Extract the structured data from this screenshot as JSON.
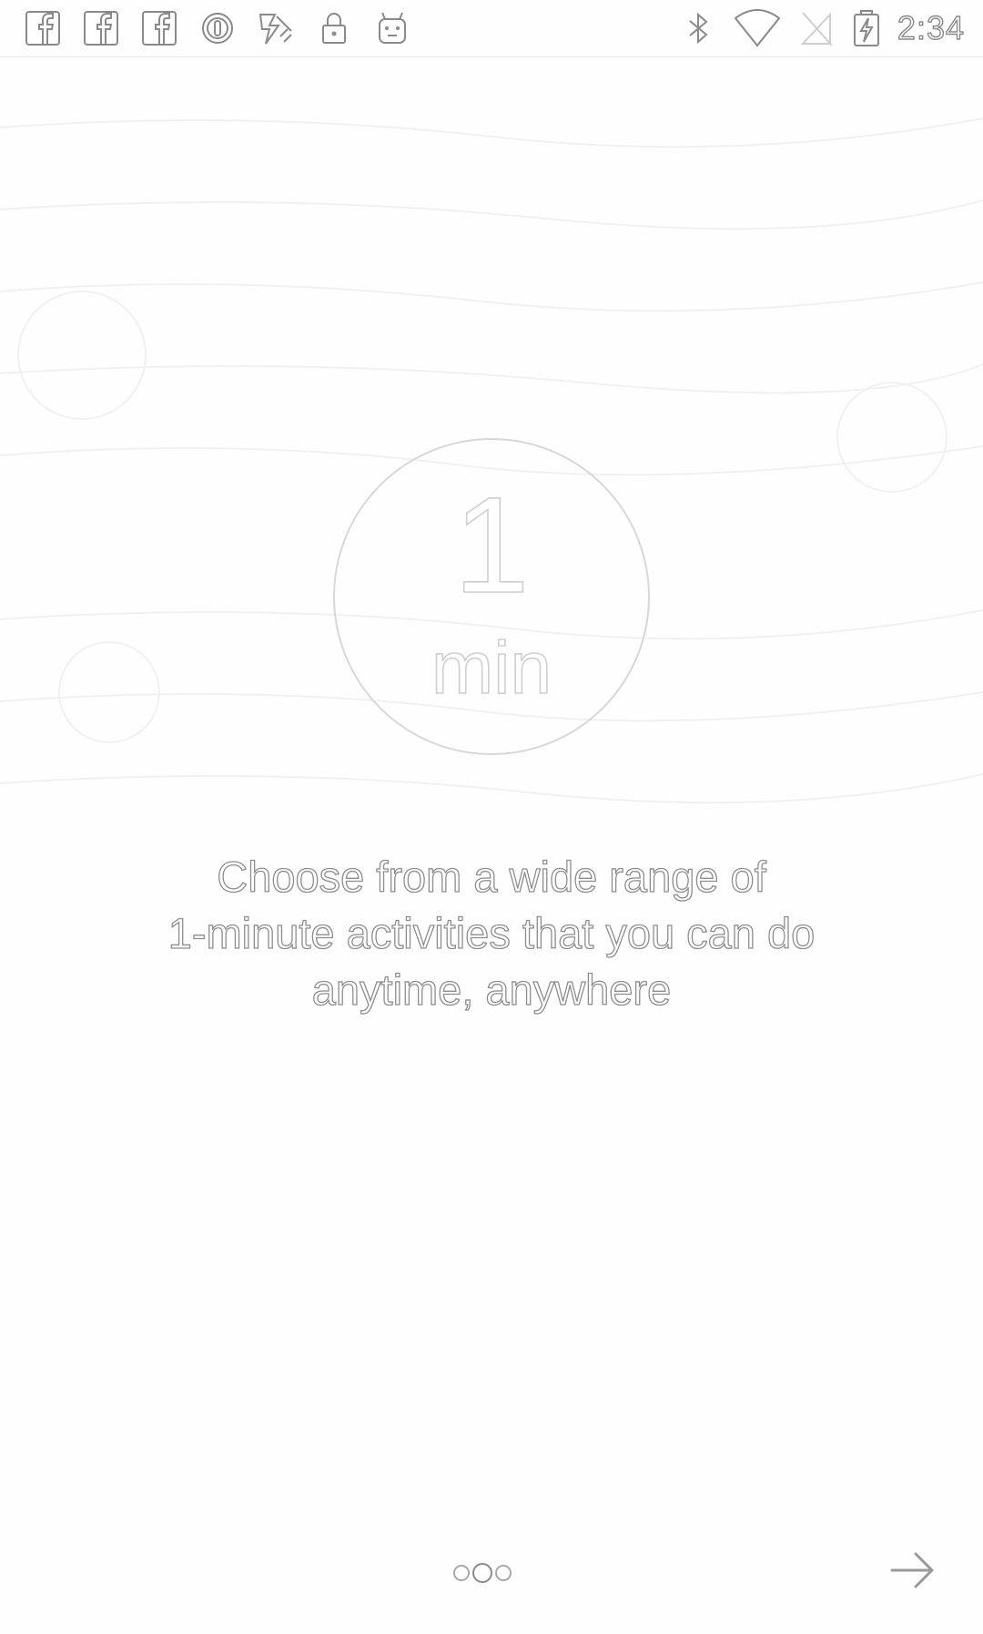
{
  "status_bar": {
    "time": "2:34",
    "left_icons": [
      "facebook-icon",
      "facebook-icon",
      "facebook-icon",
      "at-sign-icon",
      "fast-charge-icon",
      "lock-icon",
      "android-icon"
    ],
    "right_icons": [
      "bluetooth-icon",
      "wifi-icon",
      "no-sim-icon",
      "battery-charging-icon"
    ]
  },
  "hero": {
    "number": "1",
    "unit": "min"
  },
  "description": {
    "lines": [
      "Choose from a wide range of",
      "1-minute activities that you can do",
      "anytime, anywhere"
    ]
  },
  "pager": {
    "count": 3,
    "active_index": 1
  },
  "next": {
    "icon": "arrow-right-icon"
  },
  "colors": {
    "outline": "#8a8a8a",
    "circle": "#d8d8d8",
    "background": "#ffffff"
  }
}
